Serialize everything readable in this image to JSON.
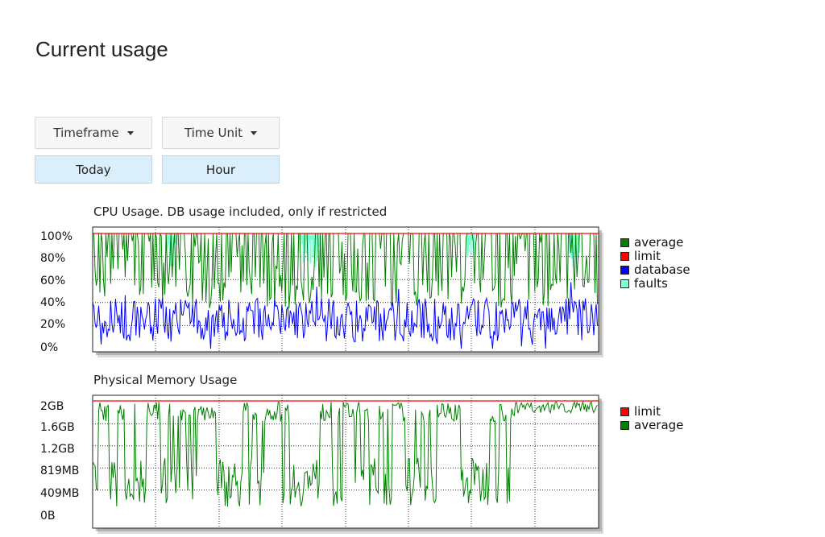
{
  "page": {
    "title": "Current usage"
  },
  "controls": {
    "timeframe": {
      "label": "Timeframe",
      "value": "Today"
    },
    "time_unit": {
      "label": "Time Unit",
      "value": "Hour"
    }
  },
  "colors": {
    "average": "#008000",
    "limit": "#ff0000",
    "database": "#0000ff",
    "faults": "#7fffd4"
  },
  "chart_data": [
    {
      "type": "line",
      "title": "CPU Usage. DB usage included, only if restricted",
      "y_ticks": [
        "100%",
        "80%",
        "60%",
        "40%",
        "20%",
        "0%"
      ],
      "ylim": [
        0,
        100
      ],
      "grid": true,
      "legend_position": "right",
      "series": [
        {
          "name": "average",
          "color": "#008000",
          "approx_range": [
            40,
            100
          ]
        },
        {
          "name": "limit",
          "color": "#ff0000",
          "constant": 100
        },
        {
          "name": "database",
          "color": "#0000ff",
          "approx_range": [
            0,
            60
          ]
        },
        {
          "name": "faults",
          "color": "#7fffd4",
          "approx_range": [
            70,
            100
          ]
        }
      ]
    },
    {
      "type": "line",
      "title": "Physical Memory Usage",
      "y_ticks": [
        "2GB",
        "1.6GB",
        "1.2GB",
        "819MB",
        "409MB",
        "0B"
      ],
      "grid": true,
      "legend_position": "right",
      "series": [
        {
          "name": "limit",
          "color": "#ff0000",
          "constant_label": "2GB"
        },
        {
          "name": "average",
          "color": "#008000",
          "approx_range": [
            "409MB",
            "2GB"
          ]
        }
      ]
    }
  ]
}
